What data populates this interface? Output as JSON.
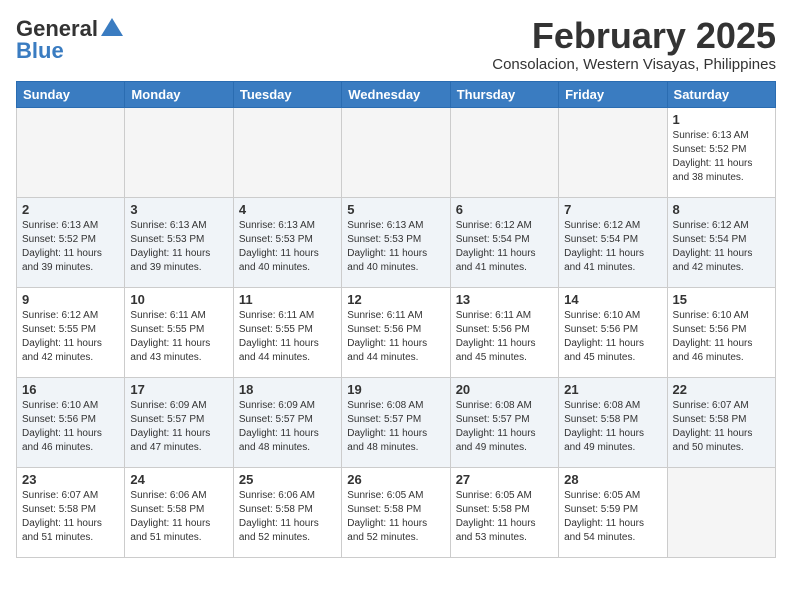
{
  "header": {
    "logo_general": "General",
    "logo_blue": "Blue",
    "month_year": "February 2025",
    "location": "Consolacion, Western Visayas, Philippines"
  },
  "weekdays": [
    "Sunday",
    "Monday",
    "Tuesday",
    "Wednesday",
    "Thursday",
    "Friday",
    "Saturday"
  ],
  "weeks": [
    [
      {
        "day": "",
        "info": ""
      },
      {
        "day": "",
        "info": ""
      },
      {
        "day": "",
        "info": ""
      },
      {
        "day": "",
        "info": ""
      },
      {
        "day": "",
        "info": ""
      },
      {
        "day": "",
        "info": ""
      },
      {
        "day": "1",
        "info": "Sunrise: 6:13 AM\nSunset: 5:52 PM\nDaylight: 11 hours\nand 38 minutes."
      }
    ],
    [
      {
        "day": "2",
        "info": "Sunrise: 6:13 AM\nSunset: 5:52 PM\nDaylight: 11 hours\nand 39 minutes."
      },
      {
        "day": "3",
        "info": "Sunrise: 6:13 AM\nSunset: 5:53 PM\nDaylight: 11 hours\nand 39 minutes."
      },
      {
        "day": "4",
        "info": "Sunrise: 6:13 AM\nSunset: 5:53 PM\nDaylight: 11 hours\nand 40 minutes."
      },
      {
        "day": "5",
        "info": "Sunrise: 6:13 AM\nSunset: 5:53 PM\nDaylight: 11 hours\nand 40 minutes."
      },
      {
        "day": "6",
        "info": "Sunrise: 6:12 AM\nSunset: 5:54 PM\nDaylight: 11 hours\nand 41 minutes."
      },
      {
        "day": "7",
        "info": "Sunrise: 6:12 AM\nSunset: 5:54 PM\nDaylight: 11 hours\nand 41 minutes."
      },
      {
        "day": "8",
        "info": "Sunrise: 6:12 AM\nSunset: 5:54 PM\nDaylight: 11 hours\nand 42 minutes."
      }
    ],
    [
      {
        "day": "9",
        "info": "Sunrise: 6:12 AM\nSunset: 5:55 PM\nDaylight: 11 hours\nand 42 minutes."
      },
      {
        "day": "10",
        "info": "Sunrise: 6:11 AM\nSunset: 5:55 PM\nDaylight: 11 hours\nand 43 minutes."
      },
      {
        "day": "11",
        "info": "Sunrise: 6:11 AM\nSunset: 5:55 PM\nDaylight: 11 hours\nand 44 minutes."
      },
      {
        "day": "12",
        "info": "Sunrise: 6:11 AM\nSunset: 5:56 PM\nDaylight: 11 hours\nand 44 minutes."
      },
      {
        "day": "13",
        "info": "Sunrise: 6:11 AM\nSunset: 5:56 PM\nDaylight: 11 hours\nand 45 minutes."
      },
      {
        "day": "14",
        "info": "Sunrise: 6:10 AM\nSunset: 5:56 PM\nDaylight: 11 hours\nand 45 minutes."
      },
      {
        "day": "15",
        "info": "Sunrise: 6:10 AM\nSunset: 5:56 PM\nDaylight: 11 hours\nand 46 minutes."
      }
    ],
    [
      {
        "day": "16",
        "info": "Sunrise: 6:10 AM\nSunset: 5:56 PM\nDaylight: 11 hours\nand 46 minutes."
      },
      {
        "day": "17",
        "info": "Sunrise: 6:09 AM\nSunset: 5:57 PM\nDaylight: 11 hours\nand 47 minutes."
      },
      {
        "day": "18",
        "info": "Sunrise: 6:09 AM\nSunset: 5:57 PM\nDaylight: 11 hours\nand 48 minutes."
      },
      {
        "day": "19",
        "info": "Sunrise: 6:08 AM\nSunset: 5:57 PM\nDaylight: 11 hours\nand 48 minutes."
      },
      {
        "day": "20",
        "info": "Sunrise: 6:08 AM\nSunset: 5:57 PM\nDaylight: 11 hours\nand 49 minutes."
      },
      {
        "day": "21",
        "info": "Sunrise: 6:08 AM\nSunset: 5:58 PM\nDaylight: 11 hours\nand 49 minutes."
      },
      {
        "day": "22",
        "info": "Sunrise: 6:07 AM\nSunset: 5:58 PM\nDaylight: 11 hours\nand 50 minutes."
      }
    ],
    [
      {
        "day": "23",
        "info": "Sunrise: 6:07 AM\nSunset: 5:58 PM\nDaylight: 11 hours\nand 51 minutes."
      },
      {
        "day": "24",
        "info": "Sunrise: 6:06 AM\nSunset: 5:58 PM\nDaylight: 11 hours\nand 51 minutes."
      },
      {
        "day": "25",
        "info": "Sunrise: 6:06 AM\nSunset: 5:58 PM\nDaylight: 11 hours\nand 52 minutes."
      },
      {
        "day": "26",
        "info": "Sunrise: 6:05 AM\nSunset: 5:58 PM\nDaylight: 11 hours\nand 52 minutes."
      },
      {
        "day": "27",
        "info": "Sunrise: 6:05 AM\nSunset: 5:58 PM\nDaylight: 11 hours\nand 53 minutes."
      },
      {
        "day": "28",
        "info": "Sunrise: 6:05 AM\nSunset: 5:59 PM\nDaylight: 11 hours\nand 54 minutes."
      },
      {
        "day": "",
        "info": ""
      }
    ]
  ]
}
